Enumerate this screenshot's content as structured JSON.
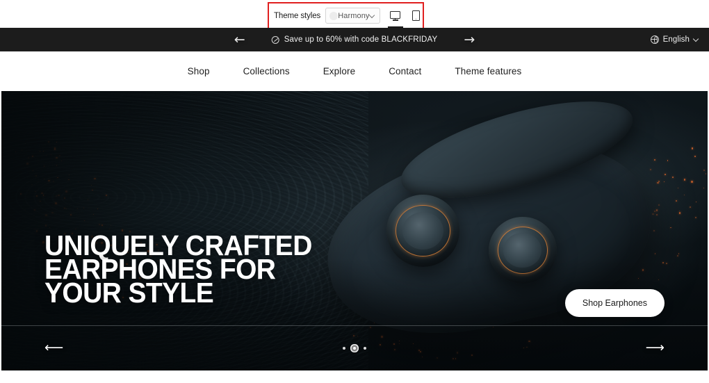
{
  "toolbar": {
    "theme_styles_label": "Theme styles",
    "style_selected": "Harmony",
    "chevron_icon": "chevron-down-icon",
    "desktop_icon": "desktop-monitor-icon",
    "mobile_icon": "mobile-phone-icon",
    "highlight_color": "#e01f1f",
    "swatch_color": "#ececec"
  },
  "announcement": {
    "prev_arrow": "←",
    "next_arrow": "→",
    "promo_icon": "discount-tag-icon",
    "text": "Save up to 60% with code BLACKFRIDAY",
    "background": "#1c1c1c",
    "language": {
      "globe_icon": "globe-icon",
      "label": "English",
      "chevron_icon": "chevron-down-icon"
    }
  },
  "nav": {
    "items": [
      {
        "label": "Shop"
      },
      {
        "label": "Collections"
      },
      {
        "label": "Explore"
      },
      {
        "label": "Contact"
      },
      {
        "label": "Theme features"
      }
    ]
  },
  "hero": {
    "title": "UNIQUELY CRAFTED\nEARPHONES FOR\nYOUR STYLE",
    "cta_label": "Shop Earphones",
    "prev_arrow": "⟵",
    "next_arrow": "⟶",
    "slides": [
      {
        "active": false
      },
      {
        "active": true
      },
      {
        "active": false
      }
    ],
    "accent_color": "#d67e36",
    "background_color": "#0a1014"
  }
}
